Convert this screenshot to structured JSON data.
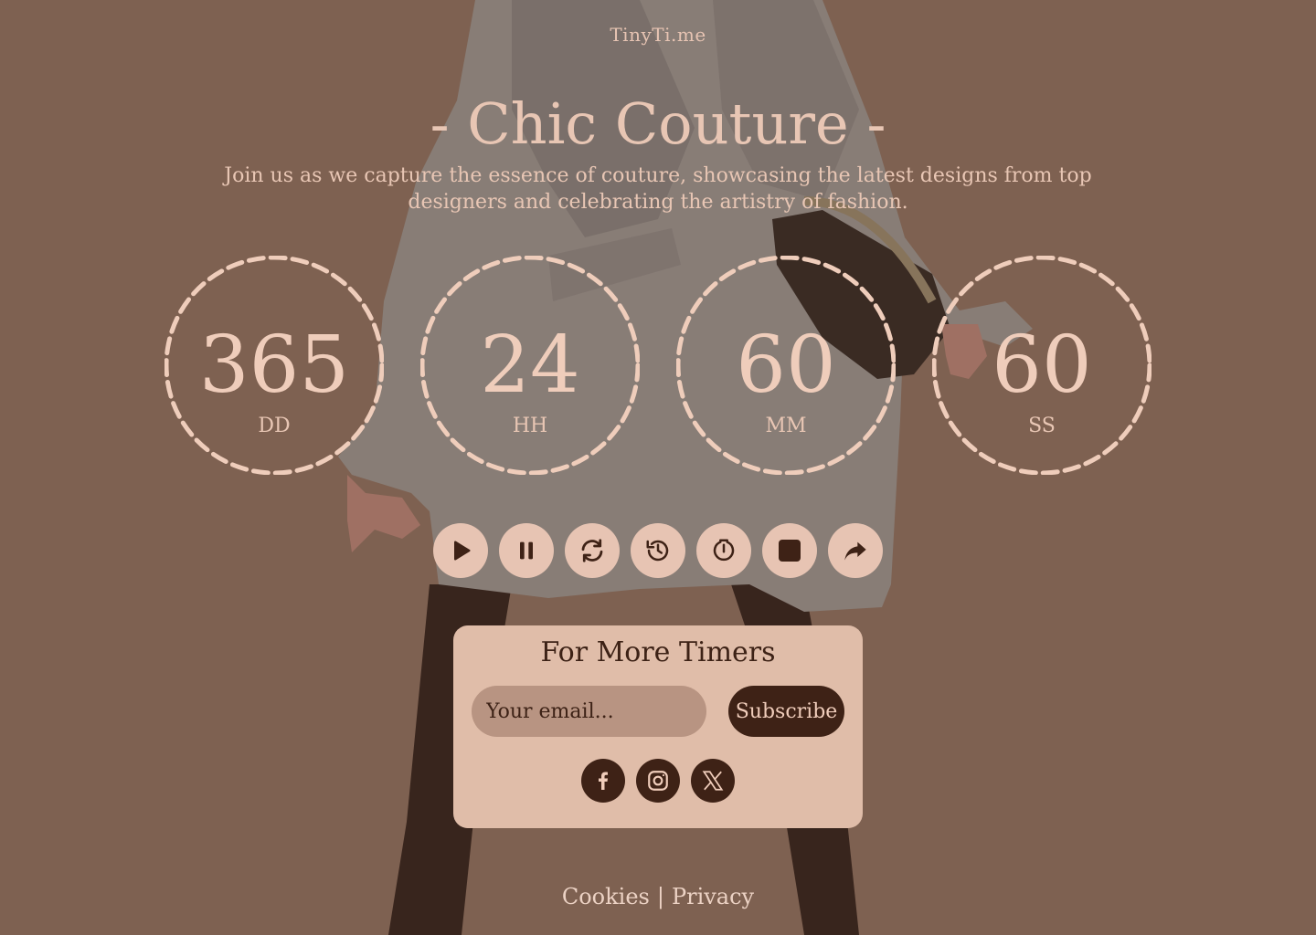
{
  "brand": "TinyTi.me",
  "title": "- Chic Couture -",
  "subtitle": "Join us as we capture the essence of couture, showcasing the latest designs from top designers and celebrating the artistry of fashion.",
  "timers": [
    {
      "value": "365",
      "label": "DD"
    },
    {
      "value": "24",
      "label": "HH"
    },
    {
      "value": "60",
      "label": "MM"
    },
    {
      "value": "60",
      "label": "SS"
    }
  ],
  "controls": [
    {
      "icon": "play-icon"
    },
    {
      "icon": "pause-icon"
    },
    {
      "icon": "refresh-icon"
    },
    {
      "icon": "history-icon"
    },
    {
      "icon": "timer-icon"
    },
    {
      "icon": "stop-icon"
    },
    {
      "icon": "share-icon"
    }
  ],
  "subscribe": {
    "heading": "For More Timers",
    "email_placeholder": "Your email...",
    "button_label": "Subscribe"
  },
  "socials": [
    {
      "icon": "facebook-icon"
    },
    {
      "icon": "instagram-icon"
    },
    {
      "icon": "x-icon"
    }
  ],
  "footer": {
    "cookies": "Cookies",
    "separator": "|",
    "privacy": "Privacy"
  },
  "colors": {
    "background": "#7f6353",
    "accent_light": "#e7c4b3",
    "accent_dark": "#3e2216",
    "card": "#e0bda9"
  }
}
